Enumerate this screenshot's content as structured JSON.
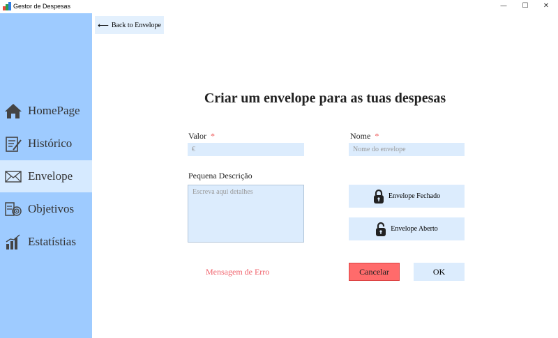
{
  "window": {
    "title": "Gestor de Despesas",
    "controls": [
      "—",
      "☐",
      "✕"
    ]
  },
  "sidebar": {
    "items": [
      {
        "label": "HomePage",
        "icon": "home-icon"
      },
      {
        "label": "Histórico",
        "icon": "history-icon"
      },
      {
        "label": "Envelope",
        "icon": "envelope-icon",
        "active": true
      },
      {
        "label": "Objetivos",
        "icon": "target-icon"
      },
      {
        "label": "Estatístias",
        "icon": "bar-chart-icon"
      }
    ]
  },
  "back_button": {
    "arrow": "⟵",
    "label": "Back to Envelope"
  },
  "heading": "Criar um envelope para as tuas despesas",
  "form": {
    "valor": {
      "label": "Valor",
      "required_mark": "*",
      "placeholder": "€"
    },
    "nome": {
      "label": "Nome",
      "required_mark": "*",
      "placeholder": "Nome do envelope"
    },
    "descricao": {
      "label": "Pequena Descrição",
      "placeholder": "Escreva aqui detalhes"
    },
    "fechado_button": "Envelope Fechado",
    "aberto_button": "Envelope Aberto",
    "error_message": "Mensagem de Erro",
    "cancel_button": "Cancelar",
    "ok_button": "OK"
  },
  "colors": {
    "sidebar": "#9ecbff",
    "active_item": "#d6eaff",
    "field": "#dcecfd",
    "cancel": "#ff6b6b",
    "error_text": "#f0606a"
  }
}
